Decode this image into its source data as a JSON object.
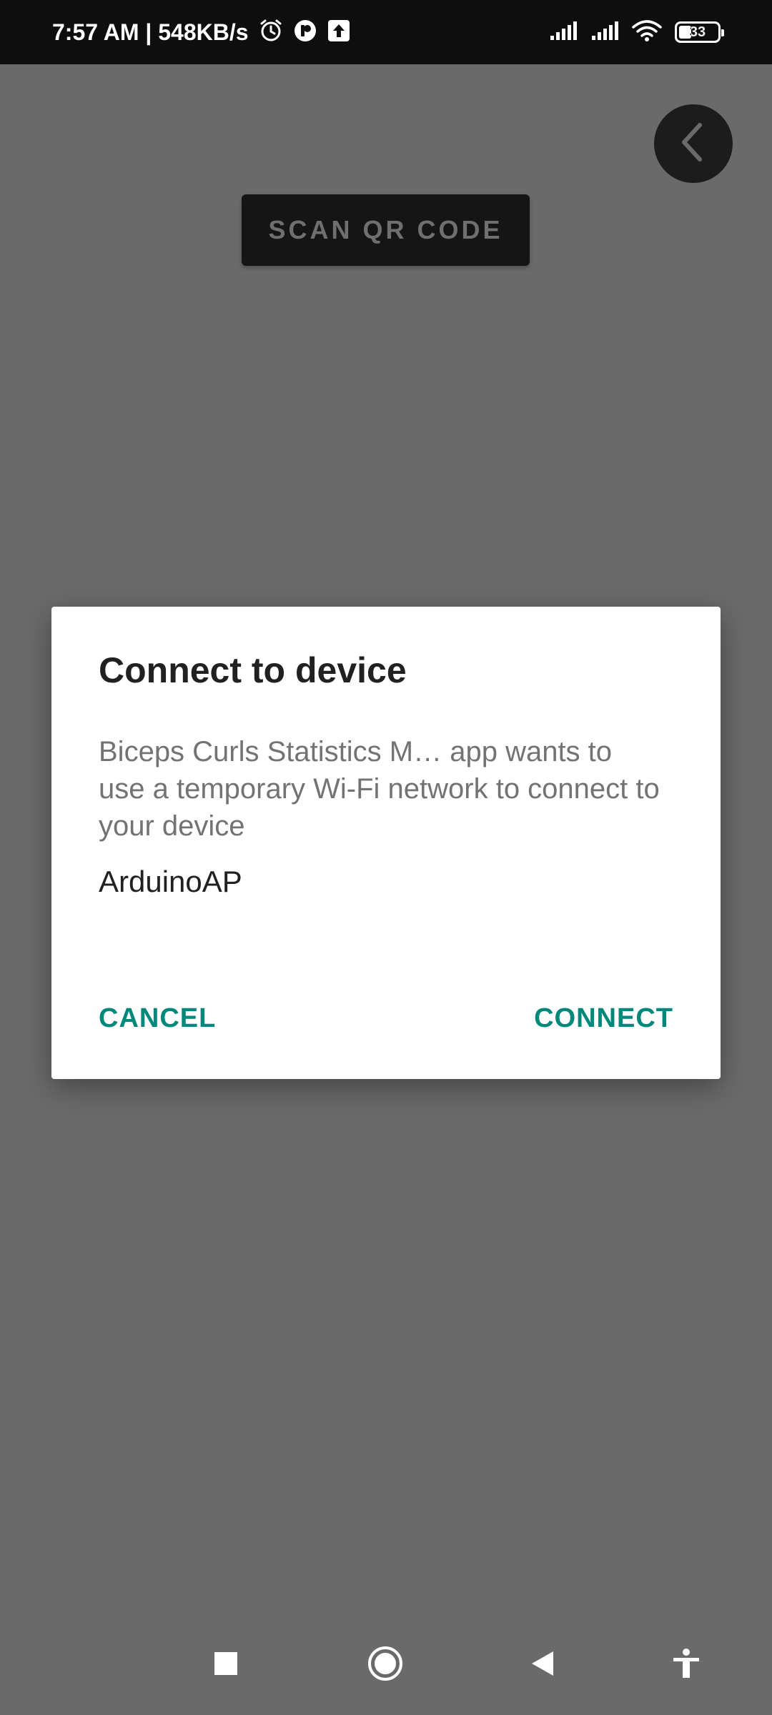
{
  "status_bar": {
    "time_speed": "7:57 AM | 548KB/s",
    "battery_level": "33",
    "battery_fraction": 0.33,
    "icons_left": [
      "alarm-icon",
      "app-notification-icon",
      "upload-icon"
    ],
    "icons_right": [
      "signal-icon",
      "signal-icon",
      "wifi-icon",
      "battery-icon"
    ]
  },
  "background": {
    "scan_button_label": "SCAN QR CODE",
    "back_icon": "chevron-left-icon"
  },
  "dialog": {
    "title": "Connect to device",
    "message": "Biceps Curls Statistics M… app wants to use a temporary Wi-Fi network to connect to your device",
    "device_name": "ArduinoAP",
    "cancel_label": "CANCEL",
    "connect_label": "CONNECT",
    "accent_color": "#00897b"
  },
  "nav_bar": {
    "items": [
      "recents-icon",
      "home-icon",
      "back-icon",
      "accessibility-icon"
    ]
  }
}
